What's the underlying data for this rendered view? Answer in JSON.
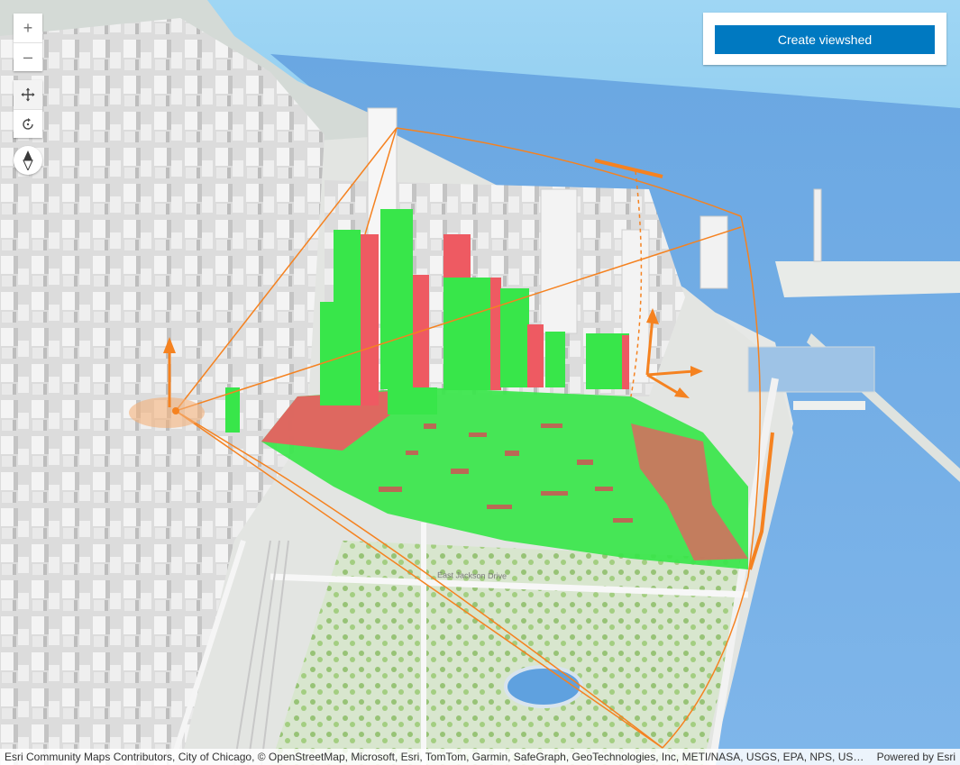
{
  "zoom": {
    "in_symbol": "+",
    "out_symbol": "–"
  },
  "navigation": {
    "pan_icon": "pan-arrows-icon",
    "rotate_icon": "rotate-icon",
    "compass_icon": "compass-icon"
  },
  "panel": {
    "create_viewshed_label": "Create viewshed"
  },
  "attribution": {
    "credits": "Esri Community Maps Contributors, City of Chicago, © OpenStreetMap, Microsoft, Esri, TomTom, Garmin, SafeGraph, GeoTechnologies, Inc, METI/NASA, USGS, EPA, NPS, US Census Bureau, USDA, USFWS",
    "powered_by": "Powered by Esri"
  },
  "map_labels": {
    "street": "East Jackson Drive"
  },
  "colors": {
    "water": "#78b0e6",
    "sky": "#8ccdf0",
    "visible_area": "#38e64a",
    "obstructed_area": "#ee5a62",
    "viewshed_frame": "#f58220",
    "button": "#0079c1"
  }
}
